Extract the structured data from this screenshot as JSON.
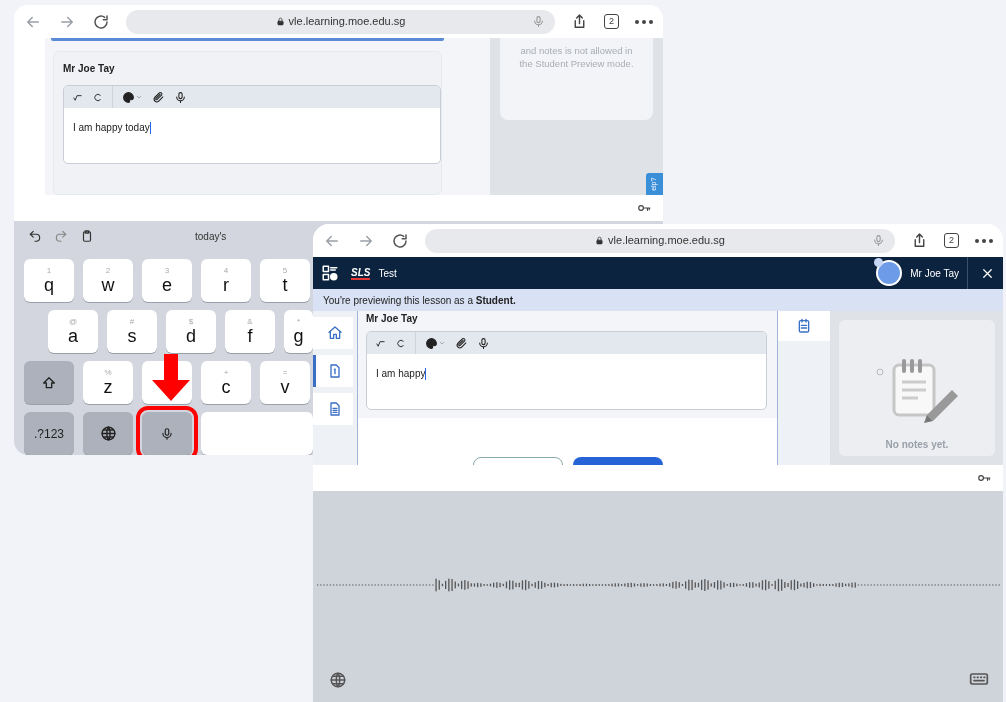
{
  "back_window": {
    "browser": {
      "url": "vle.learning.moe.edu.sg",
      "tab_count": "2"
    },
    "comment": {
      "author": "Mr Joe Tay",
      "text": "I am happy today"
    },
    "notes_message": "and notes is not allowed in the Student Preview mode.",
    "help_tab": "elp?",
    "keyboard": {
      "suggestion": "today's",
      "rows": [
        [
          {
            "kind": "letter",
            "label": "q",
            "hint": "1"
          },
          {
            "kind": "letter",
            "label": "w",
            "hint": "2"
          },
          {
            "kind": "letter",
            "label": "e",
            "hint": "3"
          },
          {
            "kind": "letter",
            "label": "r",
            "hint": "4"
          },
          {
            "kind": "letter",
            "label": "t",
            "hint": "5"
          }
        ],
        [
          {
            "kind": "letter",
            "label": "a",
            "hint": "@"
          },
          {
            "kind": "letter",
            "label": "s",
            "hint": "#"
          },
          {
            "kind": "letter",
            "label": "d",
            "hint": "$"
          },
          {
            "kind": "letter",
            "label": "f",
            "hint": "&"
          },
          {
            "kind": "letter",
            "label": "g",
            "hint": "*"
          }
        ],
        [
          {
            "kind": "shift"
          },
          {
            "kind": "letter",
            "label": "z",
            "hint": "%"
          },
          {
            "kind": "covered"
          },
          {
            "kind": "letter",
            "label": "c",
            "hint": "+"
          },
          {
            "kind": "letter",
            "label": "v",
            "hint": "="
          }
        ],
        [
          {
            "kind": "mode",
            "label": ".?123"
          },
          {
            "kind": "globe"
          },
          {
            "kind": "mic",
            "highlighted": true
          },
          {
            "kind": "space"
          }
        ]
      ]
    }
  },
  "front_window": {
    "browser": {
      "url": "vle.learning.moe.edu.sg",
      "tab_count": "2"
    },
    "app_bar": {
      "logo": "SLS",
      "lesson_title": "Test",
      "user_name": "Mr Joe Tay"
    },
    "preview_banner": "You're previewing this lesson as a **Student.**",
    "sidebar": [
      {
        "kind": "home",
        "selected": false
      },
      {
        "kind": "page",
        "selected": true
      },
      {
        "kind": "document",
        "selected": false
      }
    ],
    "comment": {
      "author": "Mr Joe Tay",
      "text": "I am happy"
    },
    "notes_empty": "No notes yet."
  }
}
